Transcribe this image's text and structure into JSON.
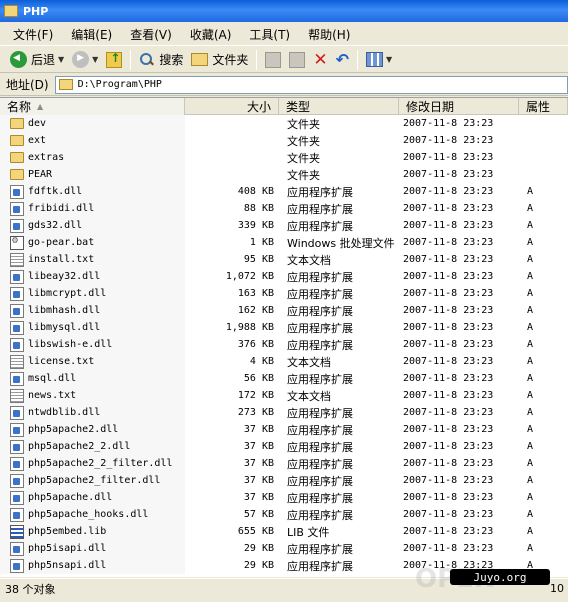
{
  "window": {
    "title": "PHP"
  },
  "menu": [
    "文件(F)",
    "编辑(E)",
    "查看(V)",
    "收藏(A)",
    "工具(T)",
    "帮助(H)"
  ],
  "toolbar": {
    "back_label": "后退",
    "search_label": "搜索",
    "folders_label": "文件夹"
  },
  "address": {
    "label": "地址(D)",
    "path": "D:\\Program\\PHP"
  },
  "columns": {
    "name": "名称",
    "size": "大小",
    "type": "类型",
    "modified": "修改日期",
    "attr": "属性"
  },
  "files": [
    {
      "name": "dev",
      "size": "",
      "type": "文件夹",
      "date": "2007-11-8 23:23",
      "attr": "",
      "icon": "folder-icon"
    },
    {
      "name": "ext",
      "size": "",
      "type": "文件夹",
      "date": "2007-11-8 23:23",
      "attr": "",
      "icon": "folder-icon"
    },
    {
      "name": "extras",
      "size": "",
      "type": "文件夹",
      "date": "2007-11-8 23:23",
      "attr": "",
      "icon": "folder-icon"
    },
    {
      "name": "PEAR",
      "size": "",
      "type": "文件夹",
      "date": "2007-11-8 23:23",
      "attr": "",
      "icon": "folder-icon"
    },
    {
      "name": "fdftk.dll",
      "size": "408 KB",
      "type": "应用程序扩展",
      "date": "2007-11-8 23:23",
      "attr": "A",
      "icon": "dll-icon"
    },
    {
      "name": "fribidi.dll",
      "size": "88 KB",
      "type": "应用程序扩展",
      "date": "2007-11-8 23:23",
      "attr": "A",
      "icon": "dll-icon"
    },
    {
      "name": "gds32.dll",
      "size": "339 KB",
      "type": "应用程序扩展",
      "date": "2007-11-8 23:23",
      "attr": "A",
      "icon": "dll-icon"
    },
    {
      "name": "go-pear.bat",
      "size": "1 KB",
      "type": "Windows 批处理文件",
      "date": "2007-11-8 23:23",
      "attr": "A",
      "icon": "batch-file-icon"
    },
    {
      "name": "install.txt",
      "size": "95 KB",
      "type": "文本文档",
      "date": "2007-11-8 23:23",
      "attr": "A",
      "icon": "text-file-icon"
    },
    {
      "name": "libeay32.dll",
      "size": "1,072 KB",
      "type": "应用程序扩展",
      "date": "2007-11-8 23:23",
      "attr": "A",
      "icon": "dll-icon"
    },
    {
      "name": "libmcrypt.dll",
      "size": "163 KB",
      "type": "应用程序扩展",
      "date": "2007-11-8 23:23",
      "attr": "A",
      "icon": "dll-icon"
    },
    {
      "name": "libmhash.dll",
      "size": "162 KB",
      "type": "应用程序扩展",
      "date": "2007-11-8 23:23",
      "attr": "A",
      "icon": "dll-icon"
    },
    {
      "name": "libmysql.dll",
      "size": "1,988 KB",
      "type": "应用程序扩展",
      "date": "2007-11-8 23:23",
      "attr": "A",
      "icon": "dll-icon"
    },
    {
      "name": "libswish-e.dll",
      "size": "376 KB",
      "type": "应用程序扩展",
      "date": "2007-11-8 23:23",
      "attr": "A",
      "icon": "dll-icon"
    },
    {
      "name": "license.txt",
      "size": "4 KB",
      "type": "文本文档",
      "date": "2007-11-8 23:23",
      "attr": "A",
      "icon": "text-file-icon"
    },
    {
      "name": "msql.dll",
      "size": "56 KB",
      "type": "应用程序扩展",
      "date": "2007-11-8 23:23",
      "attr": "A",
      "icon": "dll-icon"
    },
    {
      "name": "news.txt",
      "size": "172 KB",
      "type": "文本文档",
      "date": "2007-11-8 23:23",
      "attr": "A",
      "icon": "text-file-icon"
    },
    {
      "name": "ntwdblib.dll",
      "size": "273 KB",
      "type": "应用程序扩展",
      "date": "2007-11-8 23:23",
      "attr": "A",
      "icon": "dll-icon"
    },
    {
      "name": "php5apache2.dll",
      "size": "37 KB",
      "type": "应用程序扩展",
      "date": "2007-11-8 23:23",
      "attr": "A",
      "icon": "dll-icon"
    },
    {
      "name": "php5apache2_2.dll",
      "size": "37 KB",
      "type": "应用程序扩展",
      "date": "2007-11-8 23:23",
      "attr": "A",
      "icon": "dll-icon"
    },
    {
      "name": "php5apache2_2_filter.dll",
      "size": "37 KB",
      "type": "应用程序扩展",
      "date": "2007-11-8 23:23",
      "attr": "A",
      "icon": "dll-icon"
    },
    {
      "name": "php5apache2_filter.dll",
      "size": "37 KB",
      "type": "应用程序扩展",
      "date": "2007-11-8 23:23",
      "attr": "A",
      "icon": "dll-icon"
    },
    {
      "name": "php5apache.dll",
      "size": "37 KB",
      "type": "应用程序扩展",
      "date": "2007-11-8 23:23",
      "attr": "A",
      "icon": "dll-icon"
    },
    {
      "name": "php5apache_hooks.dll",
      "size": "57 KB",
      "type": "应用程序扩展",
      "date": "2007-11-8 23:23",
      "attr": "A",
      "icon": "dll-icon"
    },
    {
      "name": "php5embed.lib",
      "size": "655 KB",
      "type": "LIB 文件",
      "date": "2007-11-8 23:23",
      "attr": "A",
      "icon": "lib-file-icon"
    },
    {
      "name": "php5isapi.dll",
      "size": "29 KB",
      "type": "应用程序扩展",
      "date": "2007-11-8 23:23",
      "attr": "A",
      "icon": "dll-icon"
    },
    {
      "name": "php5nsapi.dll",
      "size": "29 KB",
      "type": "应用程序扩展",
      "date": "2007-11-8 23:23",
      "attr": "A",
      "icon": "dll-icon"
    }
  ],
  "status": {
    "count_text": "38 个对象",
    "right_text": "10"
  },
  "watermark": {
    "text": "Juyo.org"
  }
}
